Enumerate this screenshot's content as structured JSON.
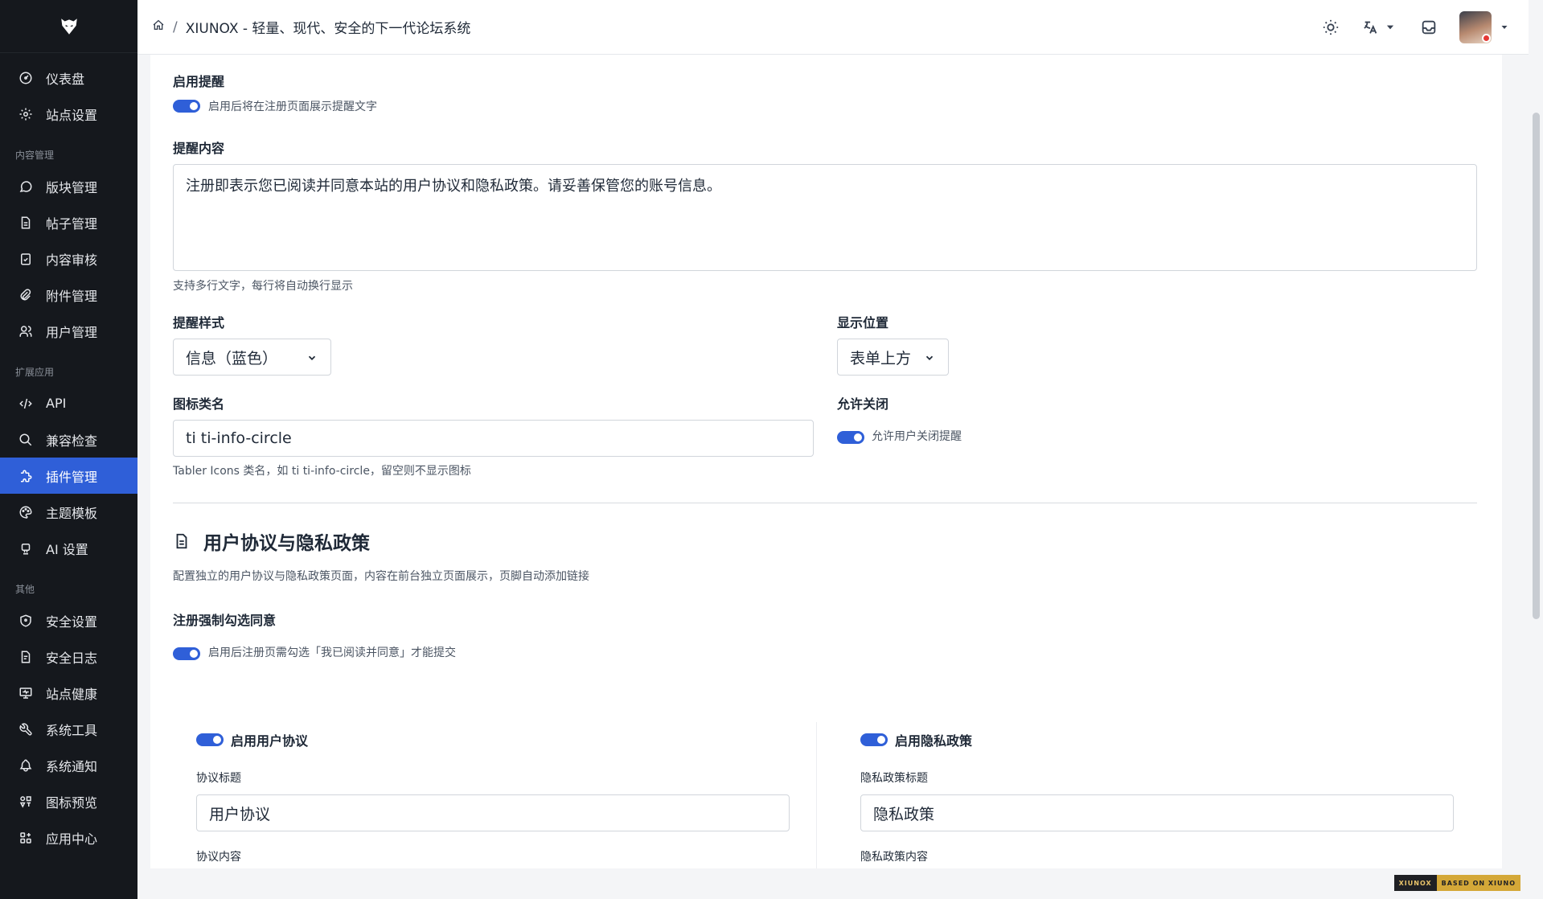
{
  "sidebar": {
    "items": [
      {
        "label": "仪表盘",
        "icon": "dashboard-icon"
      },
      {
        "label": "站点设置",
        "icon": "settings-icon"
      }
    ],
    "section_content": "内容管理",
    "content_items": [
      {
        "label": "版块管理",
        "icon": "message-circle-icon"
      },
      {
        "label": "帖子管理",
        "icon": "file-text-icon"
      },
      {
        "label": "内容审核",
        "icon": "clipboard-check-icon"
      },
      {
        "label": "附件管理",
        "icon": "paperclip-icon"
      },
      {
        "label": "用户管理",
        "icon": "users-icon"
      }
    ],
    "section_ext": "扩展应用",
    "ext_items": [
      {
        "label": "API",
        "icon": "code-icon"
      },
      {
        "label": "兼容检查",
        "icon": "search-icon"
      },
      {
        "label": "插件管理",
        "icon": "puzzle-icon",
        "active": true
      },
      {
        "label": "主题模板",
        "icon": "palette-icon"
      },
      {
        "label": "AI 设置",
        "icon": "robot-icon"
      }
    ],
    "section_other": "其他",
    "other_items": [
      {
        "label": "安全设置",
        "icon": "shield-icon"
      },
      {
        "label": "安全日志",
        "icon": "file-log-icon"
      },
      {
        "label": "站点健康",
        "icon": "device-desktop-icon"
      },
      {
        "label": "系统工具",
        "icon": "tool-icon"
      },
      {
        "label": "系统通知",
        "icon": "bell-icon"
      },
      {
        "label": "图标预览",
        "icon": "icons-icon"
      },
      {
        "label": "应用中心",
        "icon": "apps-icon"
      }
    ]
  },
  "header": {
    "breadcrumb_title": "XIUNOX - 轻量、现代、安全的下一代论坛系统",
    "breadcrumb_sep": "/"
  },
  "form": {
    "enable_notice_label": "启用提醒",
    "enable_notice_hint": "启用后将在注册页面展示提醒文字",
    "notice_content_label": "提醒内容",
    "notice_content_value": "注册即表示您已阅读并同意本站的用户协议和隐私政策。请妥善保管您的账号信息。",
    "notice_content_hint": "支持多行文字，每行将自动换行显示",
    "notice_style_label": "提醒样式",
    "notice_style_value": "信息（蓝色）",
    "position_label": "显示位置",
    "position_value": "表单上方",
    "icon_class_label": "图标类名",
    "icon_class_value": "ti ti-info-circle",
    "icon_class_hint": "Tabler Icons 类名，如 ti ti-info-circle，留空则不显示图标",
    "allow_close_label": "允许关闭",
    "allow_close_hint": "允许用户关闭提醒"
  },
  "policy": {
    "title": "用户协议与隐私政策",
    "desc": "配置独立的用户协议与隐私政策页面，内容在前台独立页面展示，页脚自动添加链接",
    "force_label": "注册强制勾选同意",
    "force_hint": "启用后注册页需勾选「我已阅读并同意」才能提交",
    "terms_enable_label": "启用用户协议",
    "terms_title_label": "协议标题",
    "terms_title_value": "用户协议",
    "terms_content_label": "协议内容",
    "privacy_enable_label": "启用隐私政策",
    "privacy_title_label": "隐私政策标题",
    "privacy_title_value": "隐私政策",
    "privacy_content_label": "隐私政策内容"
  },
  "footer_badge": {
    "left": "XIUNOX",
    "right": "BASED ON XIUNO"
  },
  "colors": {
    "accent": "#2f5fd8",
    "sidebar_bg": "#15181d"
  }
}
